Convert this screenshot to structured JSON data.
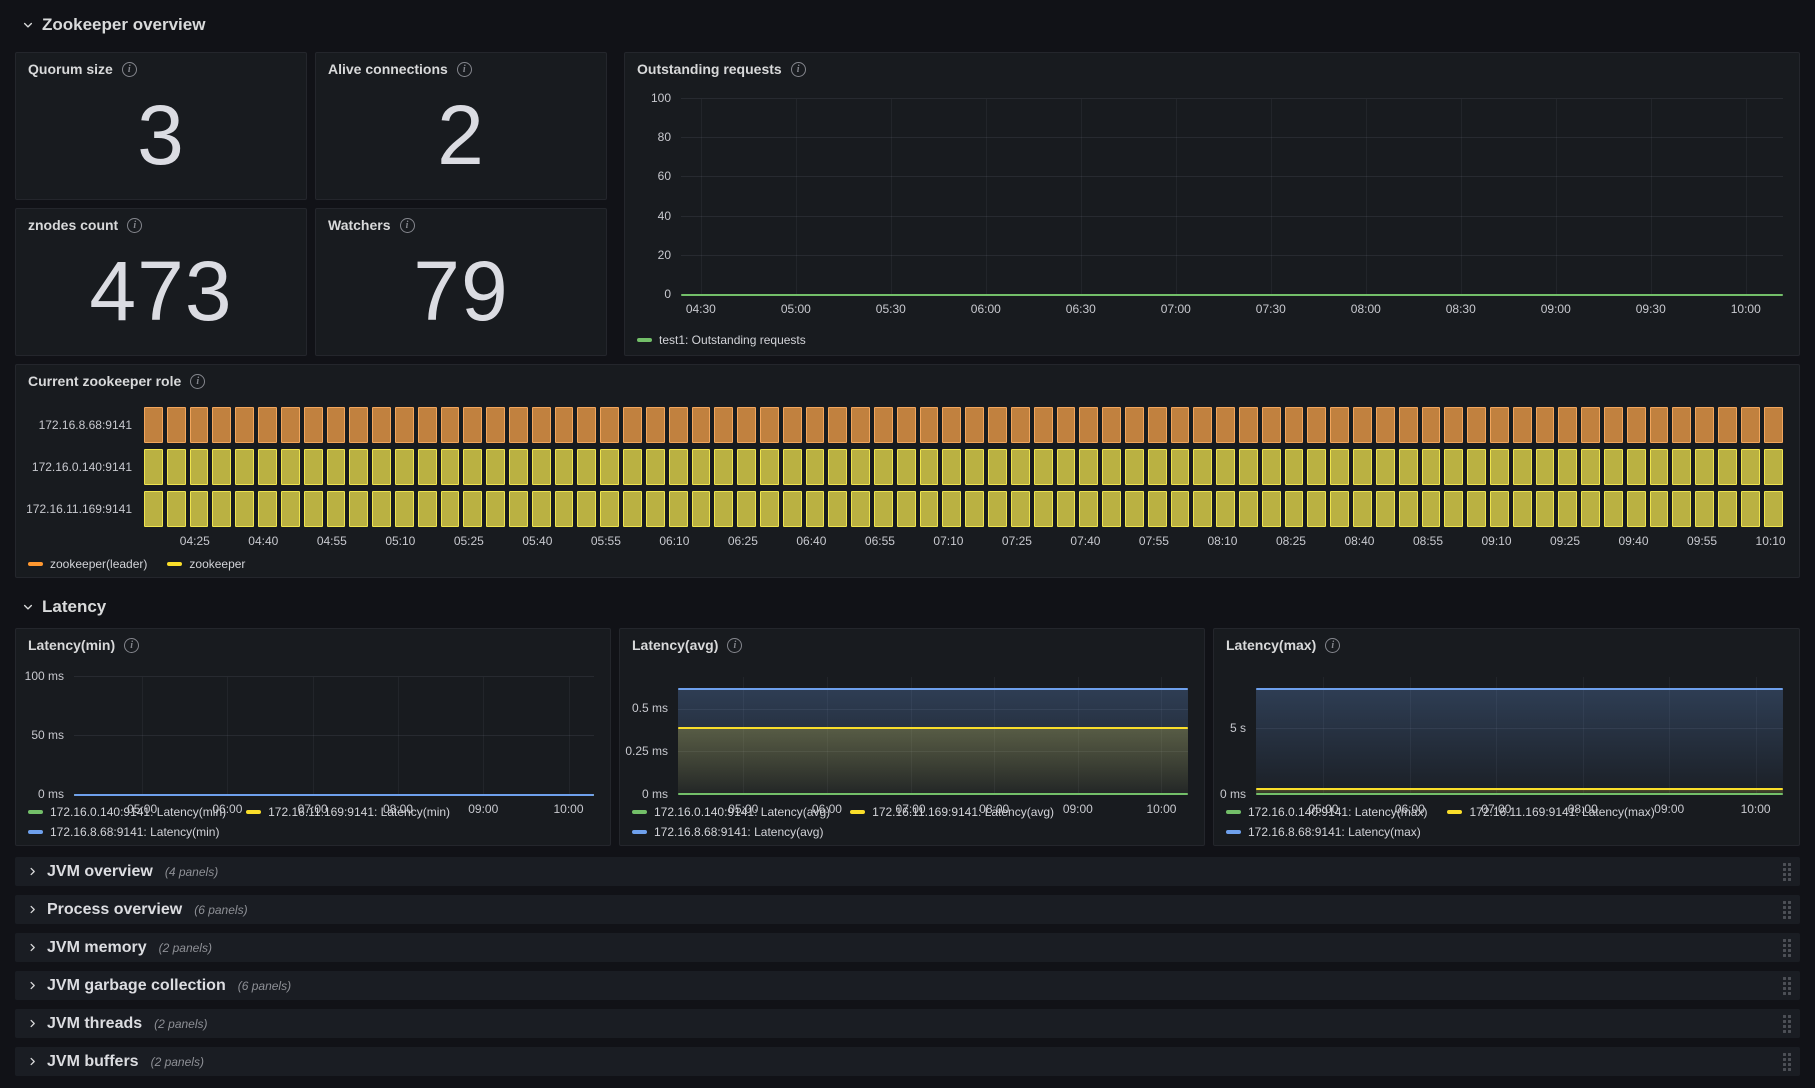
{
  "palette": {
    "green": "#73bf69",
    "yellow": "#fade2a",
    "blue": "#6ea0ec",
    "orange": "#ff9830"
  },
  "sections": {
    "overview": "Zookeeper overview",
    "latency": "Latency"
  },
  "stats": [
    {
      "title": "Quorum size",
      "value": "3"
    },
    {
      "title": "Alive connections",
      "value": "2"
    },
    {
      "title": "znodes count",
      "value": "473"
    },
    {
      "title": "Watchers",
      "value": "79"
    }
  ],
  "chart_data": [
    {
      "id": "outstanding",
      "type": "line",
      "title": "Outstanding requests",
      "ylim": [
        0,
        100
      ],
      "y_ticks": [
        {
          "v": 0,
          "label": "0"
        },
        {
          "v": 20,
          "label": "20"
        },
        {
          "v": 40,
          "label": "40"
        },
        {
          "v": 60,
          "label": "60"
        },
        {
          "v": 80,
          "label": "80"
        },
        {
          "v": 100,
          "label": "100"
        }
      ],
      "x_ticks": [
        "04:30",
        "05:00",
        "05:30",
        "06:00",
        "06:30",
        "07:00",
        "07:30",
        "08:00",
        "08:30",
        "09:00",
        "09:30",
        "10:00"
      ],
      "series": [
        {
          "name": "test1: Outstanding requests",
          "color": "#73bf69",
          "value": 0,
          "fill": false
        }
      ],
      "legend_rows": [
        [
          {
            "color": "#73bf69",
            "label": "test1: Outstanding requests"
          }
        ]
      ]
    },
    {
      "id": "role",
      "type": "state-timeline",
      "title": "Current zookeeper role",
      "rows": [
        {
          "label": "172.16.8.68:9141",
          "state": "zookeeper(leader)"
        },
        {
          "label": "172.16.0.140:9141",
          "state": "zookeeper"
        },
        {
          "label": "172.16.11.169:9141",
          "state": "zookeeper"
        }
      ],
      "bar_count": 72,
      "state_styles": {
        "zookeeper(leader)": {
          "fill": "#c1813f",
          "border": "#f2a65c"
        },
        "zookeeper": {
          "fill": "#bab142",
          "border": "#efe44e"
        }
      },
      "x_ticks": [
        "04:25",
        "04:40",
        "04:55",
        "05:10",
        "05:25",
        "05:40",
        "05:55",
        "06:10",
        "06:25",
        "06:40",
        "06:55",
        "07:10",
        "07:25",
        "07:40",
        "07:55",
        "08:10",
        "08:25",
        "08:40",
        "08:55",
        "09:10",
        "09:25",
        "09:40",
        "09:55",
        "10:10"
      ],
      "legend_rows": [
        [
          {
            "color": "#ff9830",
            "label": "zookeeper(leader)"
          },
          {
            "color": "#fade2a",
            "label": "zookeeper"
          }
        ]
      ]
    },
    {
      "id": "lat-min",
      "type": "line",
      "title": "Latency(min)",
      "ylim": [
        0,
        100
      ],
      "y_ticks": [
        {
          "v": 0,
          "label": "0 ms"
        },
        {
          "v": 50,
          "label": "50 ms"
        },
        {
          "v": 100,
          "label": "100 ms"
        }
      ],
      "x_ticks": [
        "05:00",
        "06:00",
        "07:00",
        "08:00",
        "09:00",
        "10:00"
      ],
      "series": [
        {
          "name": "172.16.0.140:9141: Latency(min)",
          "color": "#73bf69",
          "value": 0,
          "fill": false
        },
        {
          "name": "172.16.11.169:9141: Latency(min)",
          "color": "#fade2a",
          "value": 0,
          "fill": false
        },
        {
          "name": "172.16.8.68:9141: Latency(min)",
          "color": "#6ea0ec",
          "value": 0,
          "fill": false
        }
      ],
      "legend_rows": [
        [
          {
            "color": "#73bf69",
            "label": "172.16.0.140:9141: Latency(min)"
          },
          {
            "color": "#fade2a",
            "label": "172.16.11.169:9141: Latency(min)"
          }
        ],
        [
          {
            "color": "#6ea0ec",
            "label": "172.16.8.68:9141: Latency(min)"
          }
        ]
      ]
    },
    {
      "id": "lat-avg",
      "type": "line",
      "title": "Latency(avg)",
      "ylim": [
        0,
        0.69
      ],
      "y_ticks": [
        {
          "v": 0,
          "label": "0 ms"
        },
        {
          "v": 0.25,
          "label": "0.25 ms"
        },
        {
          "v": 0.5,
          "label": "0.5 ms"
        }
      ],
      "x_ticks": [
        "05:00",
        "06:00",
        "07:00",
        "08:00",
        "09:00",
        "10:00"
      ],
      "series": [
        {
          "name": "172.16.0.140:9141: Latency(avg)",
          "color": "#73bf69",
          "value": 0.004,
          "fill": false
        },
        {
          "name": "172.16.11.169:9141: Latency(avg)",
          "color": "#fade2a",
          "value": 0.39,
          "fill": true
        },
        {
          "name": "172.16.8.68:9141: Latency(avg)",
          "color": "#6ea0ec",
          "value": 0.62,
          "fill": true
        }
      ],
      "legend_rows": [
        [
          {
            "color": "#73bf69",
            "label": "172.16.0.140:9141: Latency(avg)"
          },
          {
            "color": "#fade2a",
            "label": "172.16.11.169:9141: Latency(avg)"
          }
        ],
        [
          {
            "color": "#6ea0ec",
            "label": "172.16.8.68:9141: Latency(avg)"
          }
        ]
      ]
    },
    {
      "id": "lat-max",
      "type": "line",
      "title": "Latency(max)",
      "ylim": [
        0,
        9
      ],
      "y_ticks": [
        {
          "v": 0,
          "label": "0 ms"
        },
        {
          "v": 5,
          "label": "5 s"
        }
      ],
      "x_ticks": [
        "05:00",
        "06:00",
        "07:00",
        "08:00",
        "09:00",
        "10:00"
      ],
      "series": [
        {
          "name": "172.16.0.140:9141: Latency(max)",
          "color": "#73bf69",
          "value": 0.07,
          "fill": false
        },
        {
          "name": "172.16.11.169:9141: Latency(max)",
          "color": "#fade2a",
          "value": 0.45,
          "fill": true
        },
        {
          "name": "172.16.8.68:9141: Latency(max)",
          "color": "#6ea0ec",
          "value": 8.1,
          "fill": true
        }
      ],
      "legend_rows": [
        [
          {
            "color": "#73bf69",
            "label": "172.16.0.140:9141: Latency(max)"
          },
          {
            "color": "#fade2a",
            "label": "172.16.11.169:9141: Latency(max)"
          }
        ],
        [
          {
            "color": "#6ea0ec",
            "label": "172.16.8.68:9141: Latency(max)"
          }
        ]
      ]
    }
  ],
  "collapsed_rows": [
    {
      "title": "JVM overview",
      "count": "(4 panels)"
    },
    {
      "title": "Process overview",
      "count": "(6 panels)"
    },
    {
      "title": "JVM memory",
      "count": "(2 panels)"
    },
    {
      "title": "JVM garbage collection",
      "count": "(6 panels)"
    },
    {
      "title": "JVM threads",
      "count": "(2 panels)"
    },
    {
      "title": "JVM buffers",
      "count": "(2 panels)"
    }
  ]
}
